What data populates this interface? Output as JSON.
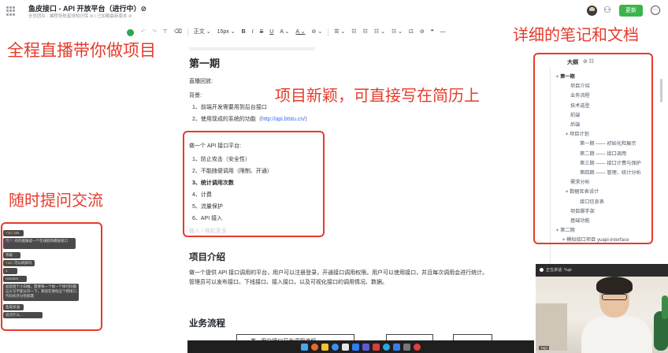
{
  "titlebar": {
    "title": "鱼皮接口 - API 开放平台（进行中）⊘",
    "subtitle": "全员团队 · 编程导航星球知识库 ⊘ | 已加载最新版本 ⊘",
    "update_label": "更新",
    "more_icon": "more-circle-icon"
  },
  "toolbar": {
    "items": [
      "↶",
      "↷",
      "⊤",
      "⌫",
      "正文 ⌄",
      "15px ⌄",
      "B",
      "I",
      "S",
      "U",
      "A ⌄",
      "A ⌄",
      "⊘ ⌄",
      "☰ ⌄",
      "☷",
      "☷",
      "☷ ⌄",
      "☷ ⌄",
      "⊡",
      "⊘",
      "❝",
      "—"
    ]
  },
  "annotations": {
    "top_left": "全程直播带你做项目",
    "top_right": "详细的笔记和文档",
    "middle": "项目新颖，可直接写在简历上",
    "left": "随时提问交流"
  },
  "doc": {
    "h1": "第一期",
    "replay": "直播回放:",
    "background": "背景:",
    "bg_items": [
      "1、前端开发需要用到后台接口",
      "2、使用现成的系统的功能（"
    ],
    "bg_link": "http://api.btstu.cn/",
    "bg_link_close": "）",
    "platform": "做一个 API 接口平台:",
    "platform_items": [
      "1、防止攻击（安全性）",
      "2、不能随便调用（限制、开通）",
      "3、统计调用次数",
      "4、计费",
      "5、流量保护",
      "6、API 接入"
    ],
    "placeholder": "输入 / 唤起更多",
    "section1_title": "项目介绍",
    "section1_text": "做一个提供 API 接口调用的平台，用户可以注册登录，开通接口调用权限。用户可以使用接口，并且每次调用会进行统计。管理员可以发布接口、下线接口、接入接口，以及可视化接口的调用情况、数据。",
    "section2_title": "业务流程",
    "flow_text": "类 - 用户接口开发调用流程"
  },
  "outline": {
    "title": "大纲",
    "items": [
      {
        "label": "第一期",
        "level": 0,
        "bold": true,
        "caret": "▾"
      },
      {
        "label": "项目介绍",
        "level": 1
      },
      {
        "label": "业务流程",
        "level": 1
      },
      {
        "label": "技术选型",
        "level": 1
      },
      {
        "label": "前端",
        "level": 1
      },
      {
        "label": "后端",
        "level": 1
      },
      {
        "label": "项目计划",
        "level": 1,
        "caret": "▾"
      },
      {
        "label": "第一期 —— 初始化和展示",
        "level": 2
      },
      {
        "label": "第二期 —— 接口调用",
        "level": 2
      },
      {
        "label": "第三期 —— 接口计费与保护",
        "level": 2
      },
      {
        "label": "第四期 —— 管理、统计分析",
        "level": 2
      },
      {
        "label": "需求分析",
        "level": 1
      },
      {
        "label": "数据库表设计",
        "level": 1,
        "caret": "▾"
      },
      {
        "label": "接口信息表",
        "level": 2
      },
      {
        "label": "项目脚手架",
        "level": 1
      },
      {
        "label": "基础功能",
        "level": 1
      },
      {
        "label": "第二期",
        "level": 0,
        "caret": "▾"
      },
      {
        "label": "模拟接口项目 yuapi-interface",
        "level": 1,
        "caret": "▾"
      }
    ]
  },
  "chat": {
    "messages": [
      {
        "user": "Yuki",
        "text": "OK"
      },
      {
        "user": "用户",
        "text": "有的能做成一个在线能和模板接口"
      },
      {
        "user": "",
        "text": "等级"
      },
      {
        "user": "Yuki",
        "text": "可以刷屏吗"
      },
      {
        "user": "",
        "text": "1"
      },
      {
        "user": "",
        "text": "reaction"
      },
      {
        "user": "",
        "text": "就是给个小白做。需要每一个样一个样代码都这么写不能分开一下，我现在要给这个把接口代码拆开分别部署"
      },
      {
        "user": "",
        "text": "鱼皮加油"
      },
      {
        "user": "",
        "text": "说点什么..."
      }
    ]
  },
  "webcam": {
    "label": "正在讲话: Yupi",
    "name": "Yupi"
  },
  "colors": {
    "annotation_red": "#e53b2c",
    "update_green": "#3ab54a",
    "link_blue": "#3370ff"
  }
}
